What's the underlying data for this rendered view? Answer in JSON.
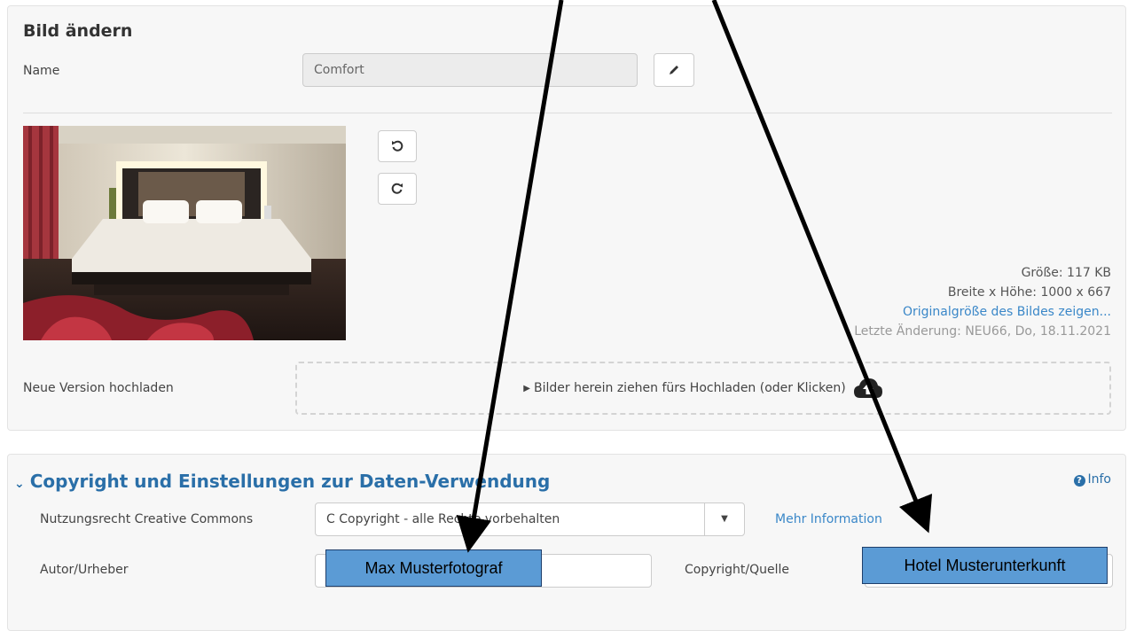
{
  "edit": {
    "title": "Bild ändern",
    "name_label": "Name",
    "name_value": "Comfort"
  },
  "image_info": {
    "size": "Größe: 117 KB",
    "dimensions": "Breite x Höhe: 1000 x 667",
    "original_link": "Originalgröße des Bildes zeigen...",
    "last_change": "Letzte Änderung: NEU66, Do, 18.11.2021"
  },
  "upload": {
    "label": "Neue Version hochladen",
    "dropzone_text": "Bilder herein ziehen fürs Hochladen (oder Klicken)"
  },
  "copyright": {
    "title": "Copyright und Einstellungen zur Daten-Verwendung",
    "info_link": "Info",
    "license_label": "Nutzungsrecht Creative Commons",
    "license_value": "C Copyright - alle Rechte vorbehalten",
    "more_info_link": "Mehr Information",
    "author_label": "Autor/Urheber",
    "source_label": "Copyright/Quelle"
  },
  "annotations": {
    "author_callout": "Max Musterfotograf",
    "source_callout": "Hotel Musterunterkunft"
  },
  "icons": {
    "edit": "pencil-icon",
    "rotate_left": "rotate-left-icon",
    "rotate_right": "rotate-right-icon",
    "upload": "cloud-upload-icon",
    "collapse": "chevron-down-icon",
    "info": "question-circle-icon"
  }
}
